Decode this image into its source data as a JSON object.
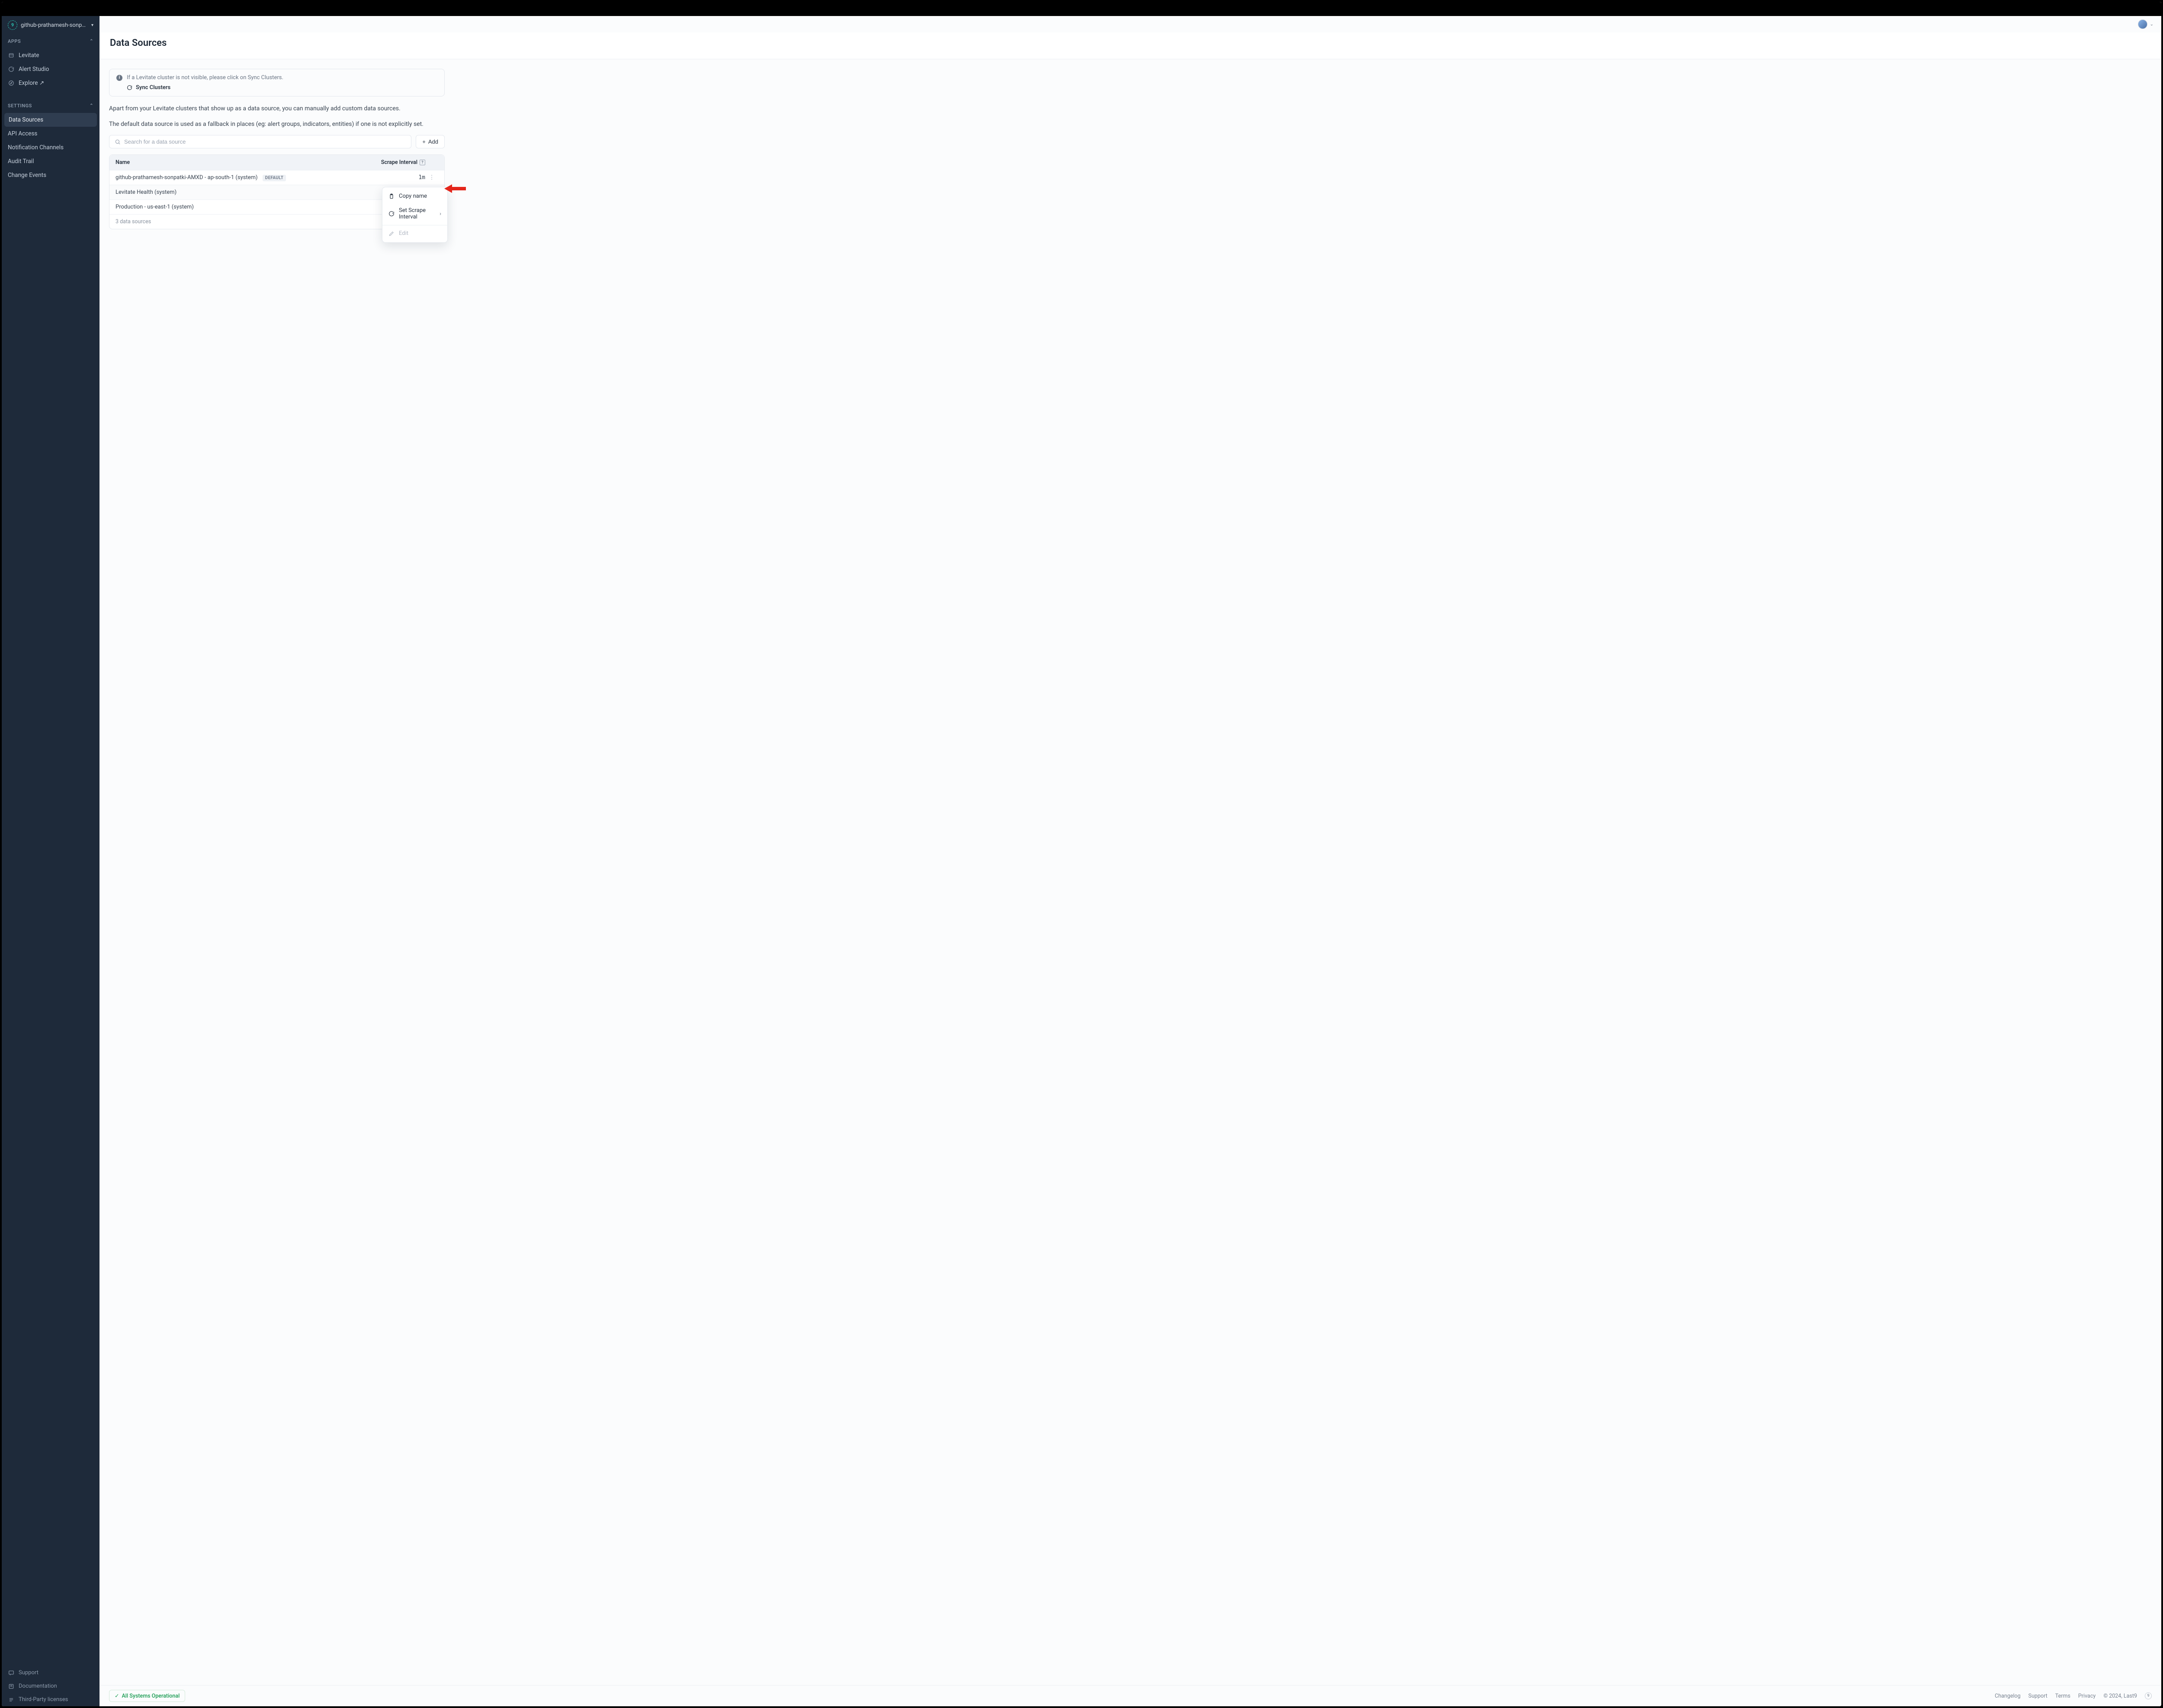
{
  "org": {
    "name": "github-prathamesh-sonpatki"
  },
  "sidebar": {
    "apps_label": "APPS",
    "settings_label": "SETTINGS",
    "apps": [
      {
        "label": "Levitate"
      },
      {
        "label": "Alert Studio"
      },
      {
        "label": "Explore ↗"
      }
    ],
    "settings": [
      {
        "label": "Data Sources"
      },
      {
        "label": "API Access"
      },
      {
        "label": "Notification Channels"
      },
      {
        "label": "Audit Trail"
      },
      {
        "label": "Change Events"
      }
    ],
    "footer": [
      {
        "label": "Support"
      },
      {
        "label": "Documentation"
      },
      {
        "label": "Third-Party licenses"
      }
    ]
  },
  "page": {
    "title": "Data Sources",
    "info_text": "If a Levitate cluster is not visible, please click on Sync Clusters.",
    "sync_label": "Sync Clusters",
    "para1": "Apart from your Levitate clusters that show up as a data source, you can manually add custom data sources.",
    "para2": "The default data source is used as a fallback in places (eg: alert groups, indicators, entities) if one is not explicitly set.",
    "search_placeholder": "Search for a data source",
    "add_label": "Add",
    "col_name": "Name",
    "col_interval": "Scrape Interval",
    "rows": [
      {
        "name": "github-prathamesh-sonpatki-AMXD - ap-south-1 (system)",
        "default": "DEFAULT",
        "interval": "1m"
      },
      {
        "name": "Levitate Health (system)",
        "default": "",
        "interval": ""
      },
      {
        "name": "Production - us-east-1 (system)",
        "default": "",
        "interval": ""
      }
    ],
    "footer_count": "3 data sources"
  },
  "context_menu": {
    "copy": "Copy name",
    "scrape": "Set Scrape Interval",
    "edit": "Edit"
  },
  "status_bar": {
    "status": "All Systems Operational",
    "links": [
      "Changelog",
      "Support",
      "Terms",
      "Privacy"
    ],
    "copyright": "© 2024, Last9"
  }
}
